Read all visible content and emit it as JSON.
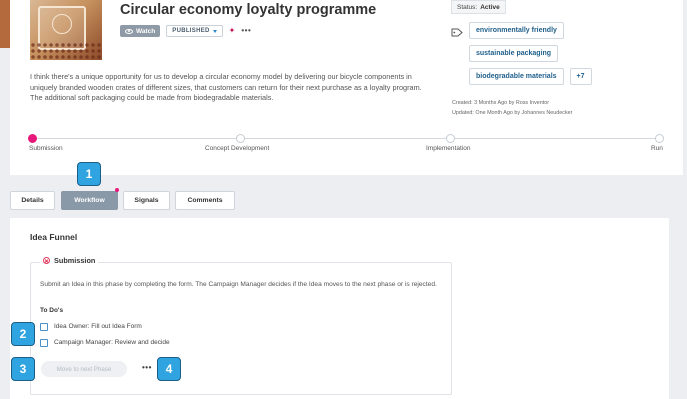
{
  "idea": {
    "title": "Circular economy loyalty programme",
    "watch_label": "Watch",
    "publish_label": "PUBLISHED",
    "share_symbol": "✦",
    "more_symbol": "•••",
    "description": "I think there's a unique opportunity for us to develop a circular economy model by delivering our bicycle components in uniquely branded wooden crates of different sizes, that customers can return for their next purchase as a loyalty program. The additional soft packaging could be made from biodegradable materials."
  },
  "status": {
    "label": "Status:",
    "value": "Active"
  },
  "tags": [
    "environmentally friendly",
    "sustainable packaging",
    "biodegradable materials"
  ],
  "tags_more": "+7",
  "created": "Created: 3 Months Ago by Ross Inventor",
  "updated": "Updated: One Month Ago by Johannes Neudecker",
  "phases": [
    "Submission",
    "Concept Development",
    "Implementation",
    "Run"
  ],
  "tabs": [
    "Details",
    "Workflow",
    "Signals",
    "Comments"
  ],
  "active_tab": "Workflow",
  "funnel": {
    "title": "Idea Funnel",
    "phase_title": "Submission",
    "phase_description": "Submit an Idea in this phase by completing the form. The Campaign Manager decides if the Idea moves to the next phase or is rejected.",
    "todos_label": "To Do's",
    "todos": [
      "Idea Owner: Fill out Idea Form",
      "Campaign Manager: Review and decide"
    ],
    "move_button": "Move to next Phase",
    "more_symbol": "•••"
  },
  "callouts": [
    "1",
    "2",
    "3",
    "4"
  ],
  "colors": {
    "accent": "#e6197a",
    "callout": "#2fa4e0",
    "tag_text": "#1f5f8b",
    "active_tab": "#8a99a8"
  }
}
